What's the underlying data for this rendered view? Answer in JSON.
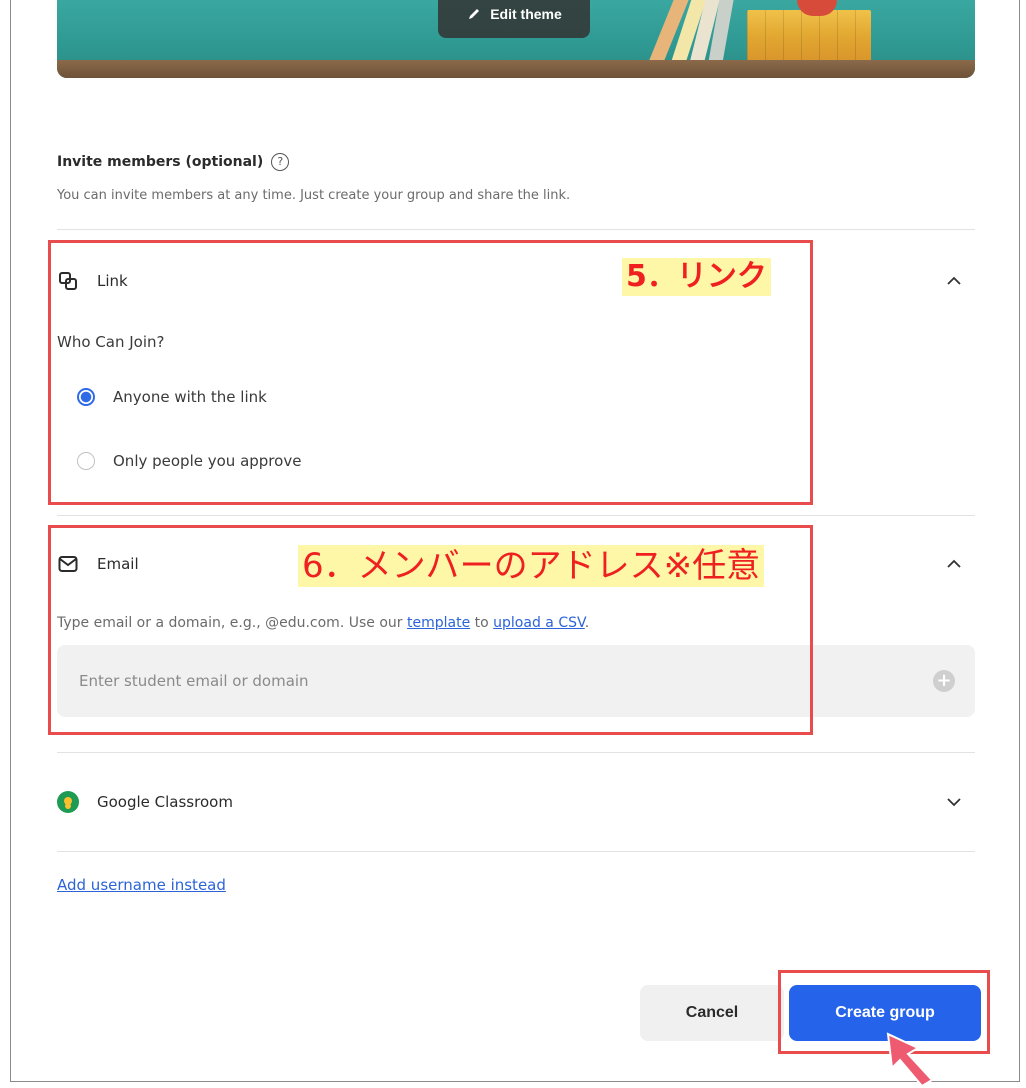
{
  "banner": {
    "edit_theme_label": "Edit theme"
  },
  "invite": {
    "title": "Invite members (optional)",
    "help_icon": "question-circle-icon",
    "subtitle": "You can invite members at any time. Just create your group and share the link."
  },
  "link_section": {
    "label": "Link",
    "icon": "link-icon",
    "who_can_join": "Who Can Join?",
    "options": [
      {
        "label": "Anyone with the link",
        "selected": true
      },
      {
        "label": "Only people you approve",
        "selected": false
      }
    ]
  },
  "email_section": {
    "label": "Email",
    "icon": "mail-icon",
    "help_prefix": "Type email or a domain, e.g., @edu.com. Use our",
    "template_link": "template",
    "help_middle": "to",
    "upload_link": "upload a CSV",
    "help_suffix": ".",
    "input_placeholder": "Enter student email or domain"
  },
  "google_section": {
    "label": "Google Classroom",
    "icon": "google-classroom-icon"
  },
  "add_username_link": "Add username instead",
  "actions": {
    "cancel_label": "Cancel",
    "create_label": "Create group",
    "primary_color": "#2563eb"
  },
  "annotations": {
    "link_label": "5．リンク",
    "email_label": "6．メンバーのアドレス※任意",
    "color": "#e84c4c",
    "highlight": "#fff7a8"
  }
}
